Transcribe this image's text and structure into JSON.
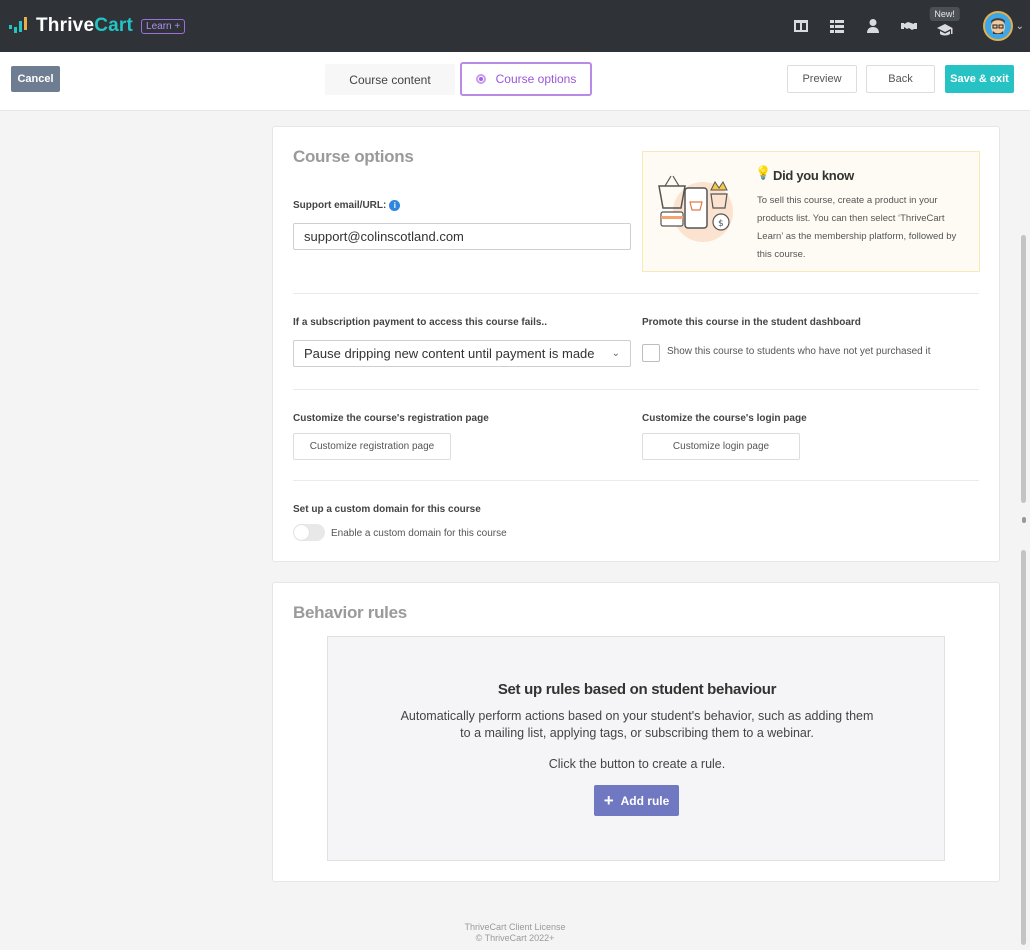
{
  "app": {
    "logo_text_a": "Thrive",
    "logo_text_b": "Cart",
    "badge": "Learn +",
    "new_badge": "New!",
    "icons": [
      "layout-icon",
      "list-icon",
      "user-icon",
      "handshake-icon",
      "graduation-cap-icon"
    ]
  },
  "toolbar": {
    "cancel": "Cancel",
    "tabs": [
      {
        "label": "Course content",
        "active": false
      },
      {
        "label": "Course options",
        "active": true
      }
    ],
    "preview": "Preview",
    "back": "Back",
    "save": "Save & exit"
  },
  "course_options": {
    "title": "Course options",
    "support_label": "Support email/URL:",
    "support_value": "support@colinscotland.com",
    "did_you_know": {
      "title": "Did you know",
      "text": "To sell this course, create a product in your products list. You can then select ‘ThriveCart Learn’ as the membership platform, followed by this course."
    },
    "payment_fail_label": "If a subscription payment to access this course fails..",
    "payment_fail_value": "Pause dripping new content until payment is made",
    "promote_label": "Promote this course in the student dashboard",
    "promote_checkbox": "Show this course to students who have not yet purchased it",
    "promote_checked": false,
    "registration_label": "Customize the course's registration page",
    "registration_button": "Customize registration page",
    "login_label": "Customize the course's login page",
    "login_button": "Customize login page",
    "domain_label": "Set up a custom domain for this course",
    "domain_toggle": "Enable a custom domain for this course",
    "domain_enabled": false
  },
  "behavior_rules": {
    "title": "Behavior rules",
    "empty_title": "Set up rules based on student behaviour",
    "empty_desc": "Automatically perform actions based on your student's behavior, such as adding them to a mailing list, applying tags, or subscribing them to a webinar.",
    "hint": "Click the button to create a rule.",
    "add_button": "Add rule"
  },
  "footer": {
    "line1": "ThriveCart Client License",
    "line2": "© ThriveCart 2022+"
  },
  "colors": {
    "accent": "#26c2c4",
    "nav_bg": "#2f3338",
    "purple": "#9a57d9",
    "add_rule": "#6f78c0"
  }
}
